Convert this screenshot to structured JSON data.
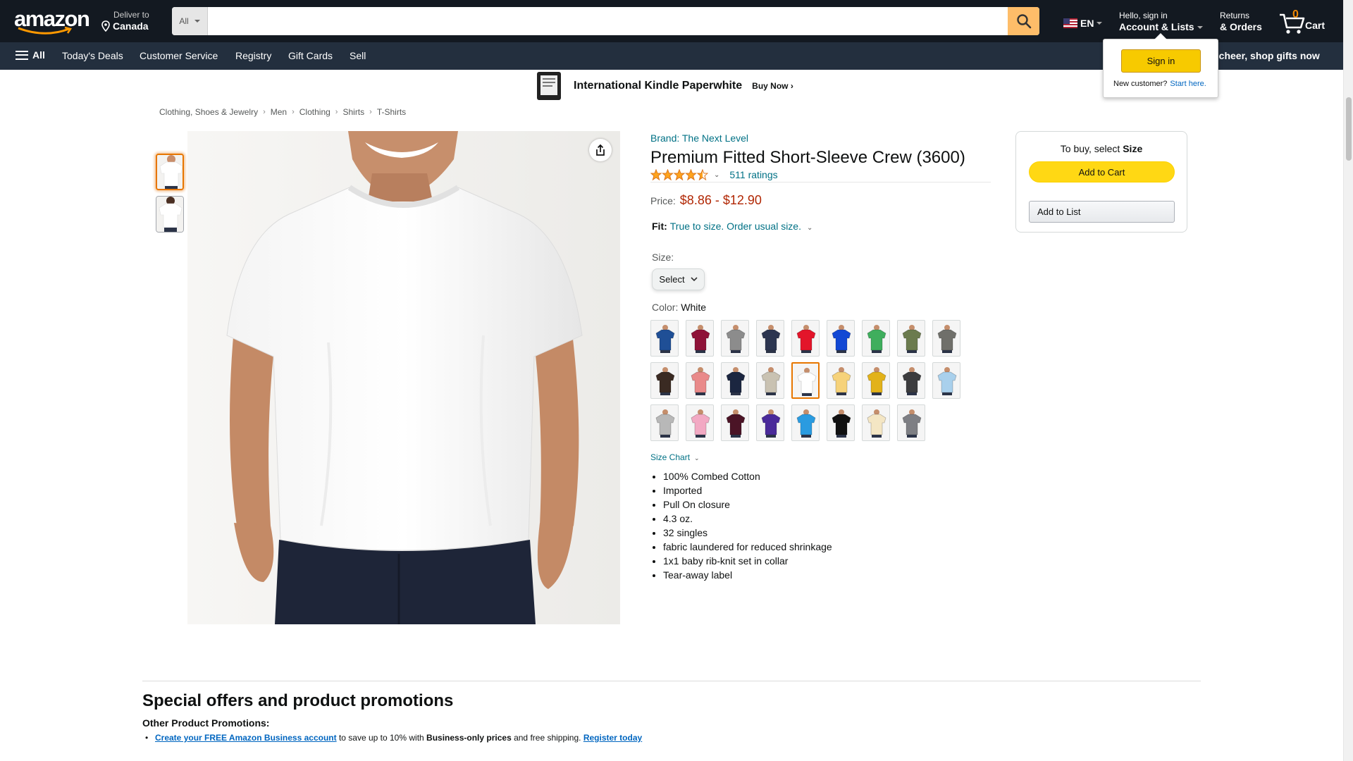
{
  "header": {
    "deliver_line1": "Deliver to",
    "deliver_line2": "Canada",
    "search_category": "All",
    "search_placeholder": "",
    "language": "EN",
    "account_line1": "Hello, sign in",
    "account_line2": "Account & Lists",
    "orders_line1": "Returns",
    "orders_line2": "& Orders",
    "cart_count": "0",
    "cart_label": "Cart"
  },
  "nav": {
    "all": "All",
    "items": [
      "Today's Deals",
      "Customer Service",
      "Registry",
      "Gift Cards",
      "Sell"
    ],
    "promo": "e cheer, shop gifts now"
  },
  "banner": {
    "title": "International Kindle Paperwhite",
    "cta": "Buy Now ›"
  },
  "signin_flyout": {
    "button": "Sign in",
    "new_customer": "New customer?",
    "start_here": "Start here."
  },
  "breadcrumb": [
    "Clothing, Shoes & Jewelry",
    "Men",
    "Clothing",
    "Shirts",
    "T-Shirts"
  ],
  "product": {
    "brand": "Brand: The Next Level",
    "title": "Premium Fitted Short-Sleeve Crew (3600)",
    "rating_value": 4.5,
    "ratings_count": "511 ratings",
    "price_label": "Price:",
    "price": "$8.86 - $12.90",
    "fit_label": "Fit:",
    "fit_text": "True to size. Order usual size.",
    "size_label": "Size:",
    "size_selected": "Select",
    "color_label": "Color:",
    "color_selected": "White",
    "size_chart": "Size Chart",
    "bullets": [
      "100% Combed Cotton",
      "Imported",
      "Pull On closure",
      "4.3 oz.",
      "32 singles",
      "fabric laundered for reduced shrinkage",
      "1x1 baby rib-knit set in collar",
      "Tear-away label"
    ],
    "swatch_colors": [
      "#1f4f96",
      "#8e1238",
      "#8c8c8c",
      "#2c3550",
      "#e3152a",
      "#1248d4",
      "#3fae5d",
      "#6b7b4e",
      "#6f6f6a",
      "#3a2a22",
      "#e98a8a",
      "#1b2640",
      "#c9c2b2",
      "#ffffff",
      "#f6d27a",
      "#e2b21a",
      "#3c3c3e",
      "#a9d0ec",
      "#b8b8b8",
      "#f2a9c3",
      "#4b1426",
      "#4a2a9a",
      "#2a9be0",
      "#111111",
      "#f4e6c4",
      "#7e7f84"
    ],
    "selected_swatch_index": 13
  },
  "buybox": {
    "prompt_prefix": "To buy, select ",
    "prompt_bold": "Size",
    "add_to_cart": "Add to Cart",
    "add_to_list": "Add to List"
  },
  "offers": {
    "heading": "Special offers and product promotions",
    "subheading": "Other Product Promotions:",
    "link1": "Create your FREE Amazon Business account",
    "text1": " to save up to 10% with ",
    "bold1": "Business-only prices",
    "text2": " and free shipping. ",
    "link2": "Register today"
  },
  "colors": {
    "header_bg": "#131921",
    "nav_bg": "#232f3e",
    "search_button": "#febd69",
    "link": "#007185",
    "price": "#b12704",
    "add_to_cart": "#ffd814",
    "star": "#ffa41c"
  }
}
